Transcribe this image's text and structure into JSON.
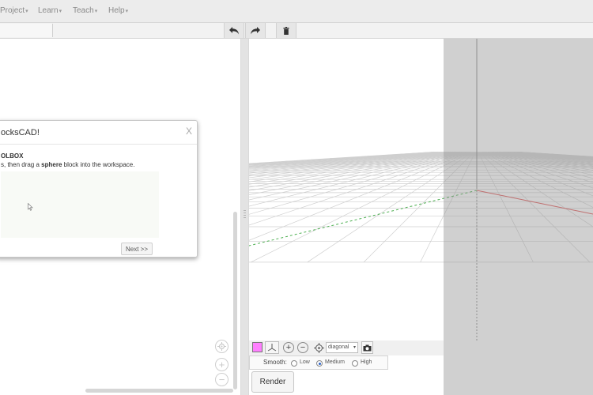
{
  "menu": {
    "items": [
      {
        "label": "Project"
      },
      {
        "label": "Learn"
      },
      {
        "label": "Teach"
      },
      {
        "label": "Help"
      }
    ]
  },
  "toolbar": {
    "undo_icon": "undo-icon",
    "redo_icon": "redo-icon",
    "delete_icon": "trash-icon"
  },
  "dialog": {
    "title": "ocksCAD!",
    "close": "X",
    "heading": "OLBOX",
    "instruction_pre": "s, then drag a ",
    "instruction_bold": "sphere",
    "instruction_post": " block into the workspace.",
    "next": "Next >>"
  },
  "viewer": {
    "color": "#ff80ff",
    "view": "diagonal",
    "smooth_label": "Smooth:",
    "smooth_options": [
      {
        "label": "Low",
        "checked": false
      },
      {
        "label": "Medium",
        "checked": true
      },
      {
        "label": "High",
        "checked": false
      }
    ],
    "render": "Render"
  }
}
